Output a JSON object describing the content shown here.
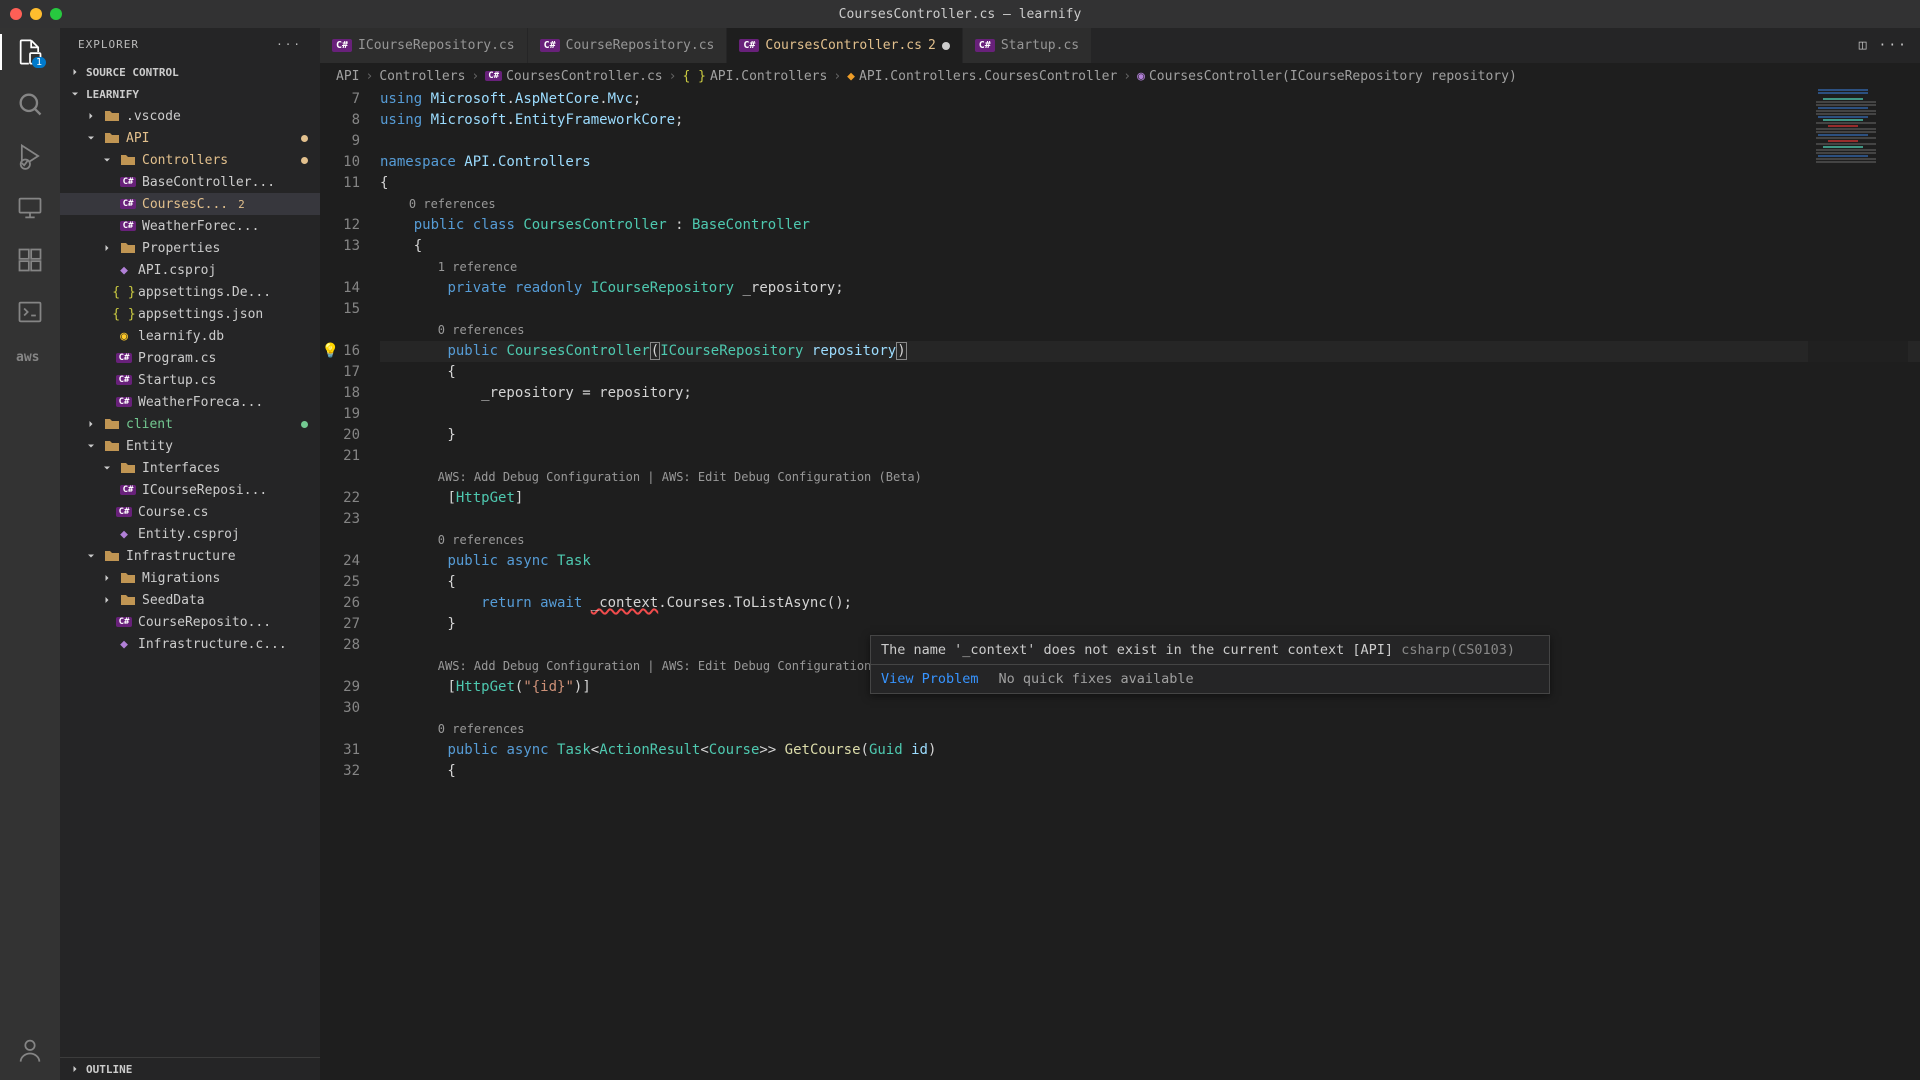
{
  "titlebar": {
    "title": "CoursesController.cs — learnify"
  },
  "activity": {
    "explorer_badge": "1",
    "aws": "aws"
  },
  "sidebar": {
    "title": "EXPLORER",
    "sections": {
      "source_control": "SOURCE CONTROL",
      "project": "LEARNIFY",
      "outline": "OUTLINE"
    },
    "tree": {
      "vscode": ".vscode",
      "api": "API",
      "controllers": "Controllers",
      "base_controller": "BaseController...",
      "courses_controller": "CoursesC...",
      "courses_badge": "2",
      "weather_forec": "WeatherForec...",
      "properties": "Properties",
      "api_csproj": "API.csproj",
      "appsettings_dev": "appsettings.De...",
      "appsettings": "appsettings.json",
      "learnify_db": "learnify.db",
      "program": "Program.cs",
      "startup": "Startup.cs",
      "weather_forecast": "WeatherForeca...",
      "client": "client",
      "entity": "Entity",
      "interfaces": "Interfaces",
      "icourse_repo": "ICourseReposi...",
      "course": "Course.cs",
      "entity_csproj": "Entity.csproj",
      "infrastructure": "Infrastructure",
      "migrations": "Migrations",
      "seed_data": "SeedData",
      "course_reposito": "CourseReposito...",
      "infra_csproj": "Infrastructure.c..."
    }
  },
  "tabs": [
    {
      "icon": "C#",
      "label": "ICourseRepository.cs"
    },
    {
      "icon": "C#",
      "label": "CourseRepository.cs"
    },
    {
      "icon": "C#",
      "label": "CoursesController.cs",
      "badge": "2",
      "active": true,
      "dirty": true
    },
    {
      "icon": "C#",
      "label": "Startup.cs"
    }
  ],
  "breadcrumb": {
    "parts": [
      "API",
      "Controllers",
      "CoursesController.cs",
      "API.Controllers",
      "API.Controllers.CoursesController",
      "CoursesController(ICourseRepository repository)"
    ]
  },
  "editor": {
    "codelens": {
      "refs0": "0 references",
      "refs1": "1 reference",
      "aws": "AWS: Add Debug Configuration | AWS: Edit Debug Configuration (Beta)"
    },
    "lines": {
      "l7": "using Microsoft.AspNetCore.Mvc;",
      "l8": "using Microsoft.EntityFrameworkCore;",
      "l9": "",
      "l10_kw": "namespace",
      "l10_ns": " API.Controllers",
      "l11": "{",
      "l12_a": "public",
      "l12_b": "class",
      "l12_c": "CoursesController",
      "l12_d": "BaseController",
      "l13": "    {",
      "l14_a": "private",
      "l14_b": "readonly",
      "l14_c": "ICourseRepository",
      "l14_d": "_repository;",
      "l15": "",
      "l16_a": "public",
      "l16_b": "CoursesController",
      "l16_c": "ICourseRepository",
      "l16_d": "repository",
      "l17": "        {",
      "l18": "            _repository = repository;",
      "l19": "",
      "l20": "        }",
      "l21": "",
      "l22_attr": "HttpGet",
      "l23": "",
      "l24_a": "public",
      "l24_b": "async",
      "l24_c": "Task",
      "l25": "        {",
      "l26_a": "return",
      "l26_b": "await",
      "l26_c": "_context",
      "l26_d": ".Courses.ToListAsync();",
      "l27": "        }",
      "l28": "",
      "l29_a": "HttpGet",
      "l29_b": "\"{id}\"",
      "l30": "",
      "l31_a": "public",
      "l31_b": "async",
      "l31_c": "Task",
      "l31_d": "ActionResult",
      "l31_e": "Course",
      "l31_f": "GetCourse",
      "l31_g": "Guid",
      "l31_h": "id",
      "l32": "        {"
    },
    "line_numbers": [
      "7",
      "8",
      "9",
      "10",
      "11",
      "",
      "12",
      "13",
      "",
      "14",
      "15",
      "",
      "16",
      "17",
      "18",
      "19",
      "20",
      "21",
      "",
      "22",
      "23",
      "",
      "24",
      "25",
      "26",
      "27",
      "28",
      "",
      "29",
      "30",
      "",
      "31",
      "32"
    ]
  },
  "hover": {
    "message": "The name '_context' does not exist in the current context [API]",
    "error_code": "csharp(CS0103)",
    "view_problem": "View Problem",
    "no_fixes": "No quick fixes available"
  }
}
